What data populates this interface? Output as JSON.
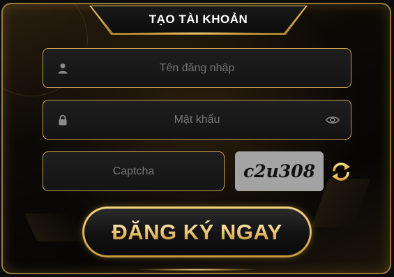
{
  "form": {
    "title": "TẠO TÀI KHOẢN",
    "username": {
      "placeholder": "Tên đăng nhập",
      "icon": "user-icon"
    },
    "password": {
      "placeholder": "Mật khẩu",
      "icon": "lock-icon",
      "toggle_icon": "eye-icon"
    },
    "captcha": {
      "placeholder": "Captcha",
      "code": "c2u308",
      "refresh_icon": "refresh-icon"
    },
    "submit_label": "ĐĂNG KÝ NGAY"
  },
  "colors": {
    "gold": "#c9a14d",
    "panel_bg": "#0d0a06",
    "placeholder": "#767676",
    "captcha_bg": "#a3a3a3"
  }
}
